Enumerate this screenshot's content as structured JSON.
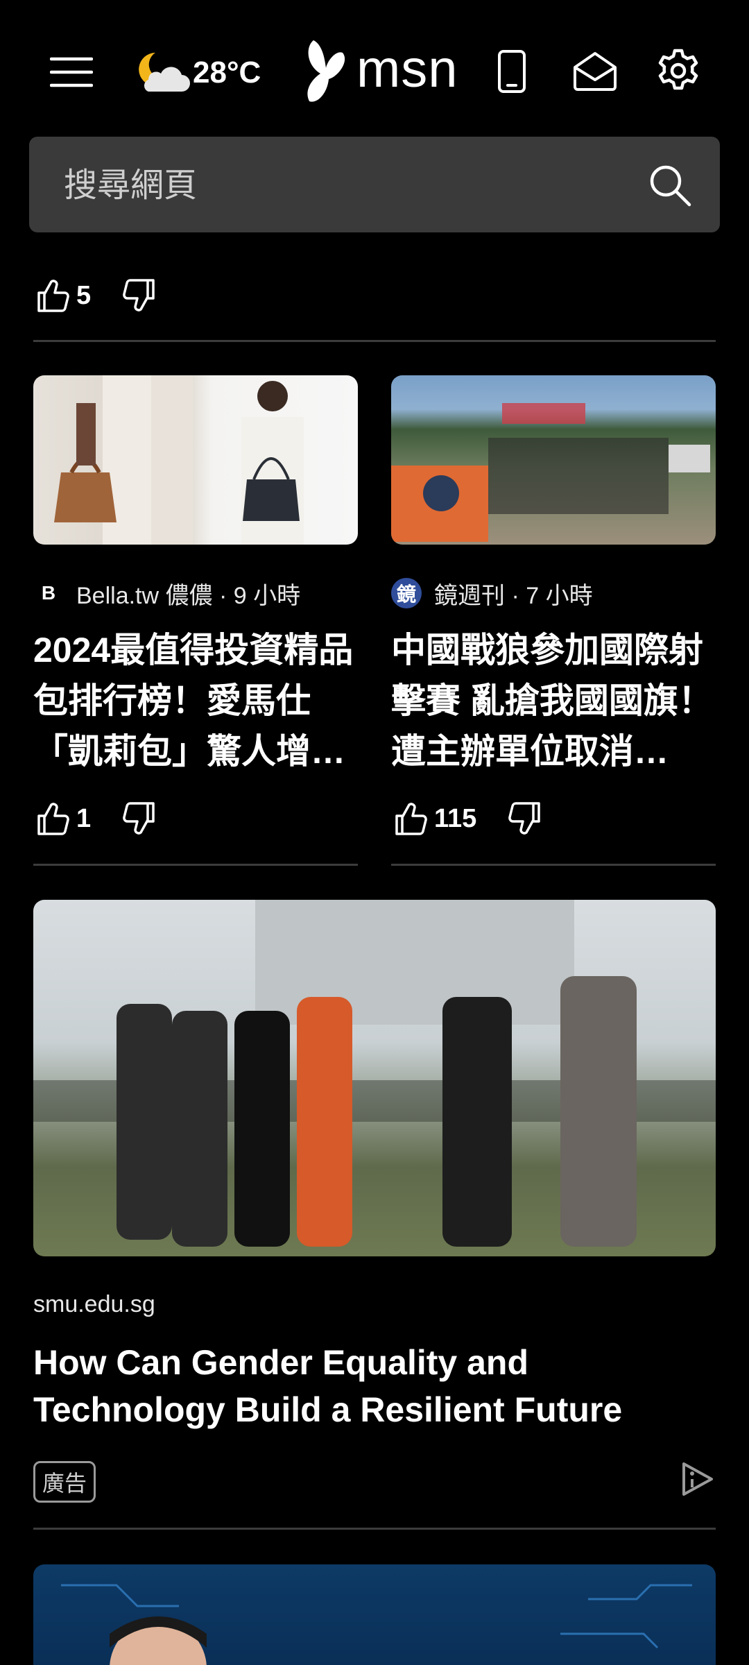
{
  "header": {
    "menu_icon": "hamburger-menu-icon",
    "weather": {
      "icon": "moon-cloud-icon",
      "temperature": "28°C"
    },
    "brand": {
      "logo_icon": "msn-butterfly-icon",
      "wordmark": "msn"
    },
    "actions": [
      {
        "name": "phone-icon"
      },
      {
        "name": "mail-icon"
      },
      {
        "name": "gear-icon"
      }
    ]
  },
  "search": {
    "placeholder": "搜尋網頁",
    "value": ""
  },
  "top_reactions": {
    "like_count": "5"
  },
  "cards": [
    {
      "source": "Bella.tw 儂儂 · 9 小時",
      "source_logo": "B",
      "title": "2024最值得投資精品包排行榜！愛馬仕「凱莉包」驚人增值率…",
      "like_count": "1"
    },
    {
      "source": "鏡週刊 · 7 小時",
      "source_logo": "鏡",
      "title": "中國戰狼參加國際射擊賽 亂搶我國國旗！遭主辦單位取消…",
      "like_count": "115"
    }
  ],
  "ad": {
    "source": "smu.edu.sg",
    "title": "How Can Gender Equality and Technology Build a Resilient Future",
    "tag": "廣告",
    "ad_choices_icon": "ad-choices-icon"
  },
  "colors": {
    "background": "#000000",
    "search_bg": "#3a3a3a",
    "divider": "#3c3c3c"
  }
}
